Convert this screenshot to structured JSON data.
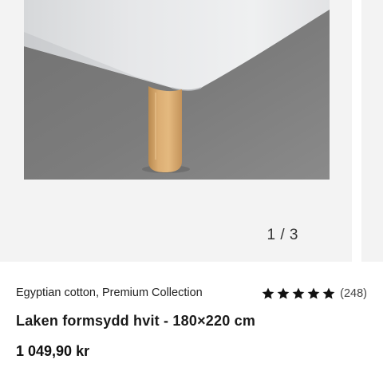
{
  "gallery": {
    "counter": "1 / 3",
    "image_alt": "Laken formsydd hvit - 180×220 cm"
  },
  "product": {
    "collection": "Egyptian cotton, Premium Collection",
    "rating_value": 5,
    "rating_max": 5,
    "rating_count": "(248)",
    "title": "Laken formsydd hvit - 180×220 cm",
    "price": "1 049,90 kr"
  },
  "colors": {
    "star": "#111111",
    "background": "#f3f3f3",
    "text": "#1a1a1a"
  }
}
